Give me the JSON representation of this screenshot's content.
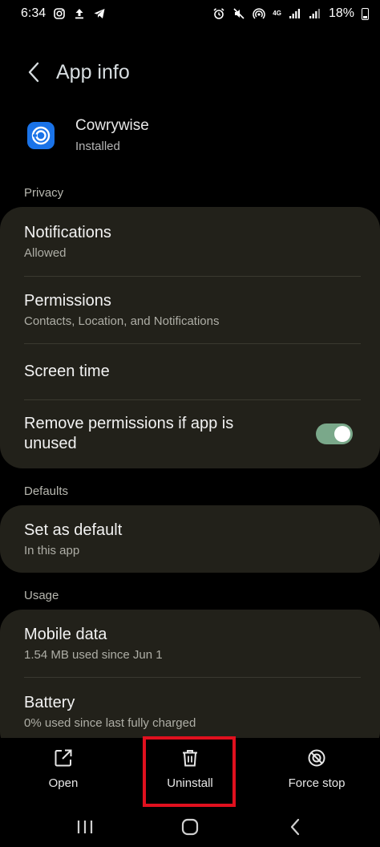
{
  "status_bar": {
    "time": "6:34",
    "network_label": "4G",
    "battery": "18%",
    "battery_level": 0.18
  },
  "header": {
    "title": "App info"
  },
  "app": {
    "name": "Cowrywise",
    "status": "Installed"
  },
  "sections": {
    "privacy": "Privacy",
    "defaults": "Defaults",
    "usage": "Usage"
  },
  "privacy_items": {
    "notifications": {
      "title": "Notifications",
      "sub": "Allowed"
    },
    "permissions": {
      "title": "Permissions",
      "sub": "Contacts, Location, and Notifications"
    },
    "screen_time": {
      "title": "Screen time"
    },
    "remove_permissions": {
      "title": "Remove permissions if app is unused",
      "enabled": true
    }
  },
  "defaults_items": {
    "set_default": {
      "title": "Set as default",
      "sub": "In this app"
    }
  },
  "usage_items": {
    "mobile_data": {
      "title": "Mobile data",
      "sub": "1.54 MB used since Jun 1"
    },
    "battery": {
      "title": "Battery",
      "sub": "0% used since last fully charged"
    }
  },
  "actions": {
    "open": "Open",
    "uninstall": "Uninstall",
    "force_stop": "Force stop"
  },
  "colors": {
    "card_bg": "#22211a",
    "toggle_on": "#7aa88a",
    "highlight": "#e0101e",
    "app_icon": "#1a73e8"
  }
}
